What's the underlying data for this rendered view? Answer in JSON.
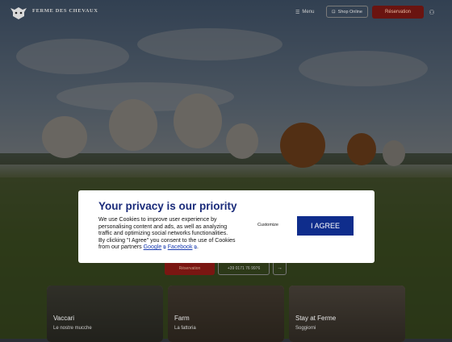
{
  "header": {
    "brand": "FERME DES CHEVAUX",
    "menu_label": "Menu",
    "shop_label": "Shop Online",
    "cta_label": "Réservation"
  },
  "hero": {
    "cta_label": "Réservation",
    "phone_label": "+39 0171 76 9976",
    "arrow": "→"
  },
  "cards": [
    {
      "title": "Vaccari",
      "sub": "Le nostre mucche"
    },
    {
      "title": "Farm",
      "sub": "La fattoria"
    },
    {
      "title": "Stay at Ferme",
      "sub": "Soggiorni"
    }
  ],
  "modal": {
    "title": "Your privacy is our priority",
    "body_prefix": "We use Cookies to improve user experience by personalising content and ads, as well as analyzing traffic and optimizing social networks functionalities. By clicking \"I Agree\" you consent to the use of Cookies from our partners ",
    "link_google": "Google",
    "link_facebook": "Facebook",
    "body_suffix": ".",
    "customize_label": "Customize",
    "agree_label": "I AGREE"
  },
  "colors": {
    "modal_title": "#1a2b7a",
    "agree_bg": "#0f2d8c",
    "cta_bg": "#6a1410"
  },
  "icons": {
    "menu": "hamburger-icon",
    "shop": "bag-icon",
    "user": "user-icon",
    "external": "external-link-icon"
  }
}
